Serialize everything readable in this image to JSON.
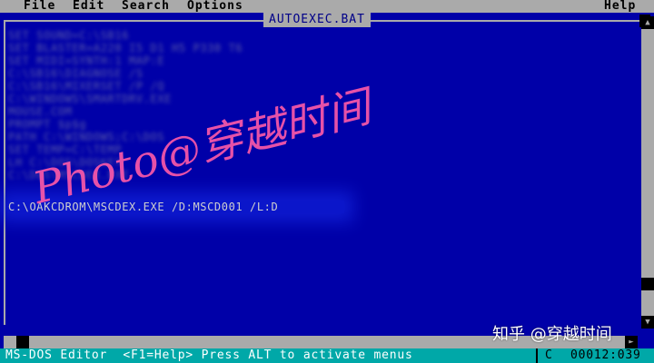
{
  "menubar": {
    "items": [
      "File",
      "Edit",
      "Search",
      "Options"
    ],
    "help": "Help"
  },
  "window": {
    "title": "AUTOEXEC.BAT"
  },
  "editor": {
    "lines": [
      "SET SOUND=C:\\SB16",
      "SET BLASTER=A220 I5 D1 H5 P330 T6",
      "SET MIDI=SYNTH:1 MAP:E",
      "C:\\SB16\\DIAGNOSE /S",
      "C:\\SB16\\MIXERSET /P /Q",
      "C:\\WINDOWS\\SMARTDRV.EXE",
      "MOUSE.COM",
      "PROMPT $p$g",
      "PATH C:\\WINDOWS;C:\\DOS",
      "SET TEMP=C:\\TEMP",
      "LH C:\\DOS\\DOSKEY",
      "C:\\DOS\\MSCDEX.EXE"
    ],
    "highlighted_line": "C:\\OAKCDROM\\MSCDEX.EXE /D:MSCD001 /L:D"
  },
  "statusbar": {
    "message": "MS-DOS Editor  <F1=Help> Press ALT to activate menus",
    "caps": "C",
    "position": "00012:039"
  },
  "watermarks": {
    "main": "Photo@穿越时间",
    "zhihu": "知乎 @穿越时间"
  },
  "colors": {
    "background": "#0000a8",
    "menubar": "#aaaaaa",
    "statusbar": "#00a8a8",
    "watermark": "#ff5aa8"
  }
}
